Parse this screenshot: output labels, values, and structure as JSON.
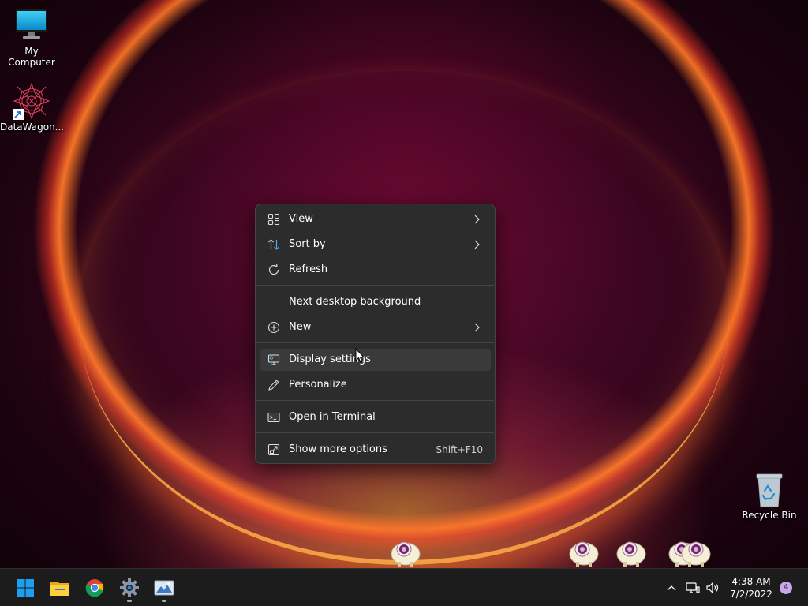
{
  "desktop": {
    "icons": [
      {
        "label": "My Computer",
        "icon": "monitor-icon"
      },
      {
        "label": "DataWagon...",
        "icon": "datawagon-shortcut-icon"
      },
      {
        "label": "Recycle Bin",
        "icon": "recycle-bin-icon"
      }
    ]
  },
  "context_menu": {
    "items": [
      {
        "label": "View",
        "icon": "grid-view-icon",
        "submenu": true
      },
      {
        "label": "Sort by",
        "icon": "sort-icon",
        "submenu": true
      },
      {
        "label": "Refresh",
        "icon": "refresh-icon"
      },
      {
        "label": "Next desktop background"
      },
      {
        "label": "New",
        "icon": "plus-circle-icon",
        "submenu": true
      },
      {
        "label": "Display settings",
        "icon": "display-settings-icon",
        "highlighted": true
      },
      {
        "label": "Personalize",
        "icon": "pencil-icon"
      },
      {
        "label": "Open in Terminal",
        "icon": "terminal-icon"
      },
      {
        "label": "Show more options",
        "icon": "show-more-icon",
        "shortcut": "Shift+F10"
      }
    ]
  },
  "taskbar": {
    "apps": [
      {
        "name": "Start",
        "icon": "windows-start-icon"
      },
      {
        "name": "File Explorer",
        "icon": "folder-icon"
      },
      {
        "name": "Google Chrome",
        "icon": "chrome-icon"
      },
      {
        "name": "Settings",
        "icon": "gear-icon",
        "running": true
      },
      {
        "name": "Image viewer",
        "icon": "picture-icon",
        "running": true
      }
    ],
    "tray": {
      "icons": [
        "chevron-up-icon",
        "network-icon",
        "volume-icon"
      ],
      "time": "4:38 AM",
      "date": "7/2/2022",
      "notification_count": "4"
    }
  },
  "colors": {
    "menu_bg": "#2c2c2c",
    "menu_hover": "#3a3a3a",
    "taskbar_bg": "#1c1c1c",
    "accent": "#0078d4"
  }
}
